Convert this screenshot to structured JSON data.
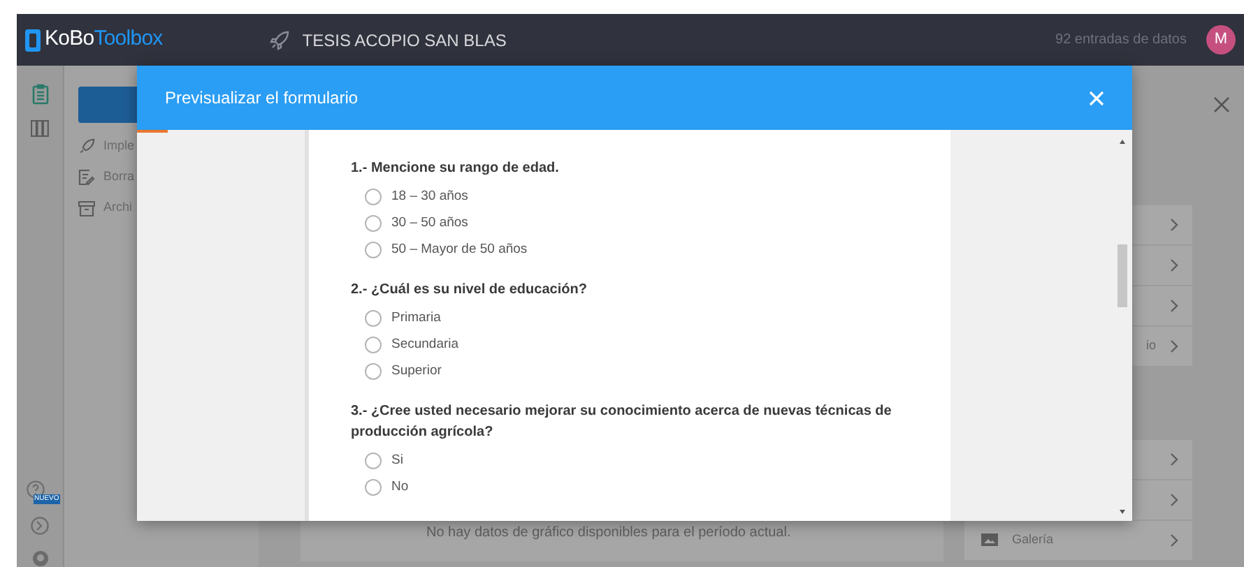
{
  "topbar": {
    "logo_a": "KoBo",
    "logo_b": "Toolbox",
    "project_title": "TESIS ACOPIO SAN BLAS",
    "entries": "92 entradas de datos",
    "avatar": "M"
  },
  "sidebar": {
    "items": [
      {
        "kind": "deploy",
        "label": "Imple"
      },
      {
        "kind": "draft",
        "label": "Borra"
      },
      {
        "kind": "archive",
        "label": "Archi"
      }
    ],
    "badge": "NUEVO"
  },
  "panel_groups": [
    [
      {
        "kind": "plain"
      },
      {
        "kind": "plain"
      },
      {
        "kind": "plain"
      },
      {
        "kind": "text",
        "label": "io"
      }
    ],
    [
      {
        "kind": "plain"
      },
      {
        "kind": "plain"
      },
      {
        "kind": "icon_text",
        "label": "Galería"
      }
    ]
  ],
  "empty_chart_message": "No hay datos de gráfico disponibles para el período actual.",
  "modal": {
    "title": "Previsualizar el formulario",
    "questions": [
      {
        "label": "1.- Mencione su rango de edad.",
        "options": [
          {
            "label": "18 – 30 años",
            "selected": false
          },
          {
            "label": "30 – 50 años",
            "selected": false
          },
          {
            "label": "50 – Mayor de 50 años",
            "selected": false
          }
        ]
      },
      {
        "label": "2.- ¿Cuál es su nivel de educación?",
        "options": [
          {
            "label": "Primaria",
            "selected": false
          },
          {
            "label": "Secundaria",
            "selected": false
          },
          {
            "label": "Superior",
            "selected": false
          }
        ]
      },
      {
        "label": "3.- ¿Cree usted necesario mejorar su conocimiento acerca de nuevas técnicas de producción agrícola?",
        "options": [
          {
            "label": "Si",
            "selected": false
          },
          {
            "label": "No",
            "selected": false
          }
        ]
      }
    ]
  }
}
